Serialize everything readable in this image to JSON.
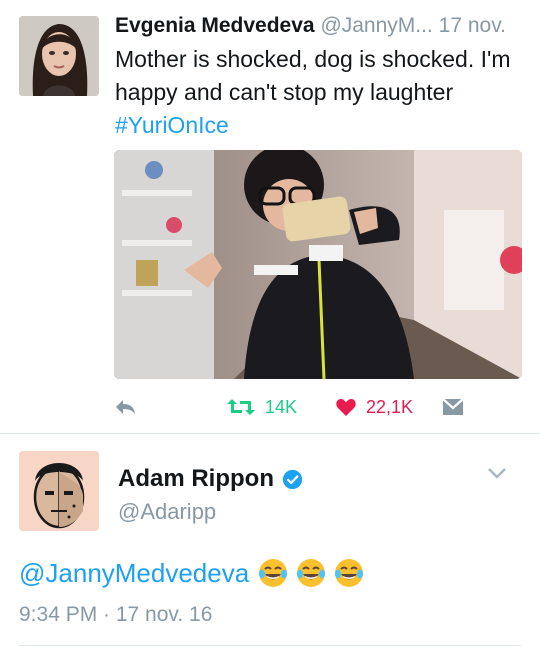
{
  "tweet1": {
    "author_name": "Evgenia Medvedeva",
    "author_handle": "@JannyM...",
    "time": "17 nov.",
    "text": "Mother is shocked, dog is shocked. I'm happy and can't stop my laughter",
    "hashtag": "#YuriOnIce",
    "retweet_count": "14K",
    "like_count": "22,1K",
    "icons": [
      "reply-icon",
      "retweet-icon",
      "like-icon",
      "direct-message-icon"
    ],
    "colors": {
      "retweet": "#19cf86",
      "like": "#e81c4f",
      "link": "#1da1f2",
      "muted": "#8899a6"
    }
  },
  "tweet2": {
    "author_name": "Adam Rippon",
    "author_handle": "@Adaripp",
    "mention": "@JannyMedvedeva",
    "emoji_names": [
      "tears-of-joy-emoji",
      "tears-of-joy-emoji",
      "tears-of-joy-emoji"
    ],
    "timestamp": "9:34 PM · 17 nov. 16",
    "icons": [
      "verified-badge-icon",
      "chevron-down-icon"
    ]
  }
}
